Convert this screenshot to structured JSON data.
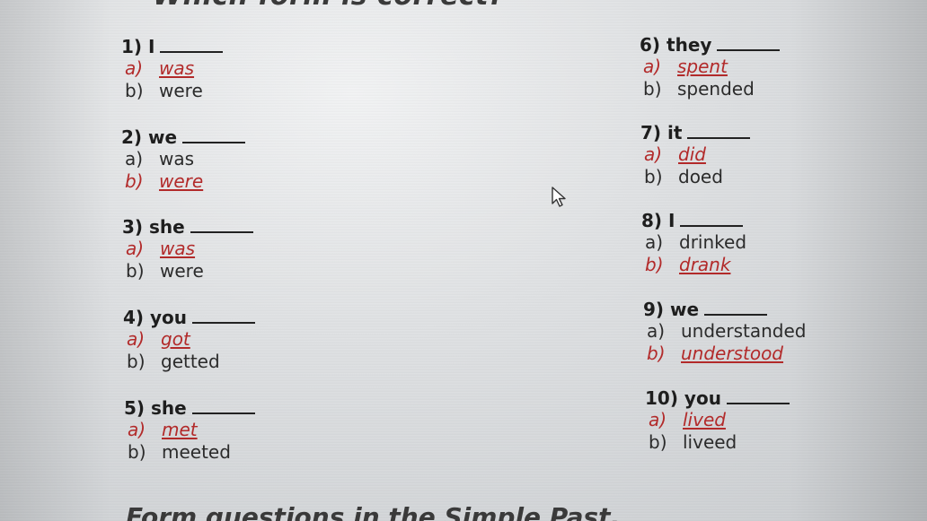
{
  "heading_cutoff": "Which form is correct?",
  "footer_cutoff": "Form questions in the Simple Past.",
  "questions": [
    {
      "title": "1) I",
      "options": [
        {
          "letter": "a)",
          "text": "was",
          "correct": true
        },
        {
          "letter": "b)",
          "text": "were",
          "correct": false
        }
      ]
    },
    {
      "title": "2) we",
      "options": [
        {
          "letter": "a)",
          "text": "was",
          "correct": false
        },
        {
          "letter": "b)",
          "text": "were",
          "correct": true
        }
      ]
    },
    {
      "title": "3) she",
      "options": [
        {
          "letter": "a)",
          "text": "was",
          "correct": true
        },
        {
          "letter": "b)",
          "text": "were",
          "correct": false
        }
      ]
    },
    {
      "title": "4) you",
      "options": [
        {
          "letter": "a)",
          "text": "got",
          "correct": true
        },
        {
          "letter": "b)",
          "text": "getted",
          "correct": false
        }
      ]
    },
    {
      "title": "5) she",
      "options": [
        {
          "letter": "a)",
          "text": "met",
          "correct": true
        },
        {
          "letter": "b)",
          "text": "meeted",
          "correct": false
        }
      ]
    },
    {
      "title": "6) they",
      "options": [
        {
          "letter": "a)",
          "text": "spent",
          "correct": true
        },
        {
          "letter": "b)",
          "text": "spended",
          "correct": false
        }
      ]
    },
    {
      "title": "7) it",
      "options": [
        {
          "letter": "a)",
          "text": "did",
          "correct": true
        },
        {
          "letter": "b)",
          "text": "doed",
          "correct": false
        }
      ]
    },
    {
      "title": "8) I",
      "options": [
        {
          "letter": "a)",
          "text": "drinked",
          "correct": false
        },
        {
          "letter": "b)",
          "text": "drank",
          "correct": true
        }
      ]
    },
    {
      "title": "9) we",
      "options": [
        {
          "letter": "a)",
          "text": "understanded",
          "correct": false
        },
        {
          "letter": "b)",
          "text": "understood",
          "correct": true
        }
      ]
    },
    {
      "title": "10) you",
      "options": [
        {
          "letter": "a)",
          "text": "lived",
          "correct": true
        },
        {
          "letter": "b)",
          "text": "liveed",
          "correct": false
        }
      ]
    }
  ],
  "colors": {
    "correct": "#b22a2a",
    "text": "#2b2b2b"
  },
  "icons": {
    "cursor": "mouse-pointer-icon"
  }
}
